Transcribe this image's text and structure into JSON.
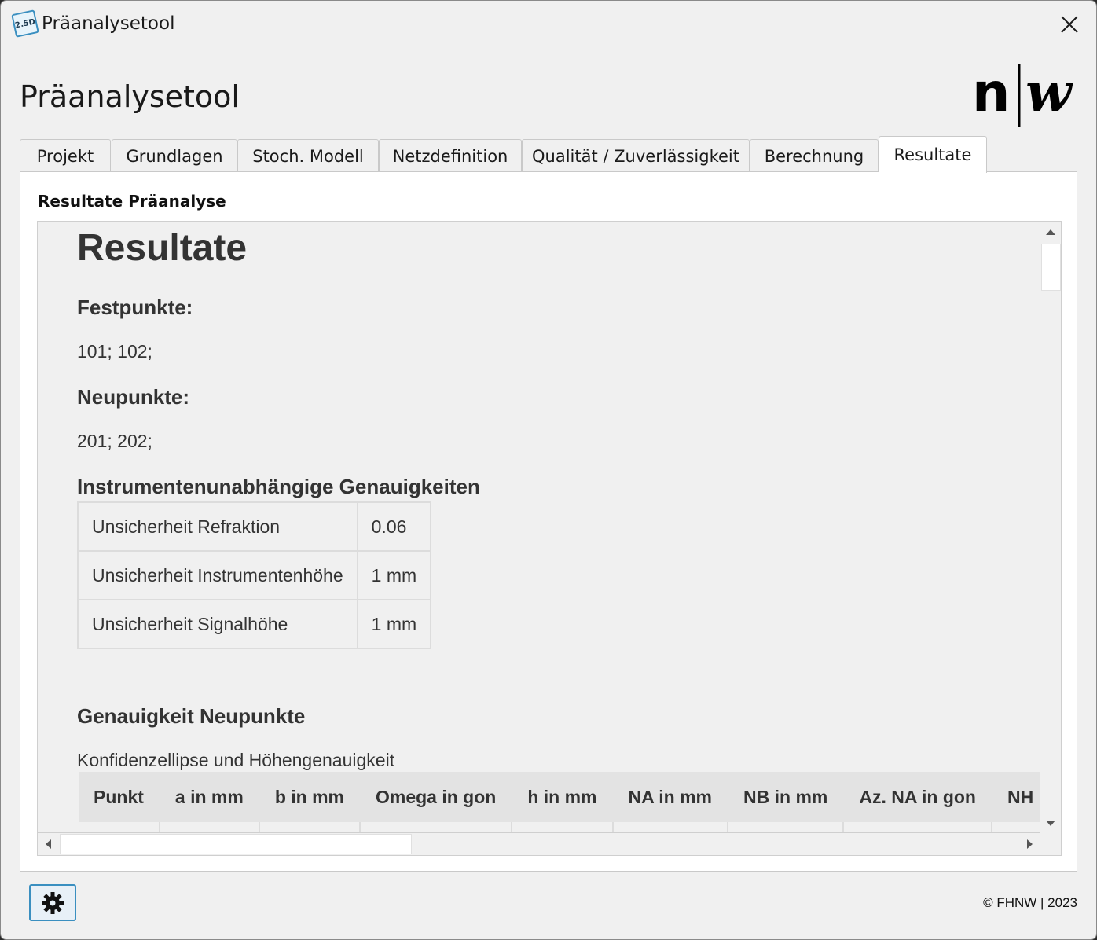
{
  "window": {
    "title": "Präanalysetool",
    "icon_label": "2.5D"
  },
  "app": {
    "title": "Präanalysetool",
    "logo_left": "n",
    "logo_right": "w"
  },
  "tabs": [
    {
      "label": "Projekt"
    },
    {
      "label": "Grundlagen"
    },
    {
      "label": "Stoch. Modell"
    },
    {
      "label": "Netzdefinition"
    },
    {
      "label": "Qualität / Zuverlässigkeit"
    },
    {
      "label": "Berechnung"
    },
    {
      "label": "Resultate"
    }
  ],
  "active_tab": "Resultate",
  "panel": {
    "heading": "Resultate Präanalyse"
  },
  "report": {
    "title": "Resultate",
    "festpunkte_heading": "Festpunkte:",
    "festpunkte_value": "101; 102;",
    "neupunkte_heading": "Neupunkte:",
    "neupunkte_value": "201; 202;",
    "genauigkeiten_heading": "Instrumentenunabhängige Genauigkeiten",
    "parameters": [
      {
        "label": "Unsicherheit Refraktion",
        "value": "0.06"
      },
      {
        "label": "Unsicherheit Instrumentenhöhe",
        "value": "1 mm"
      },
      {
        "label": "Unsicherheit Signalhöhe",
        "value": "1 mm"
      }
    ],
    "neupunkte_genauigkeit_heading": "Genauigkeit Neupunkte",
    "neupunkte_genauigkeit_subtitle": "Konfidenzellipse und Höhengenauigkeit",
    "results_columns": [
      "Punkt",
      "a in mm",
      "b in mm",
      "Omega in gon",
      "h in mm",
      "NA in mm",
      "NB in mm",
      "Az. NA in gon",
      "NH i"
    ]
  },
  "footer": {
    "copyright": "© FHNW | 2023"
  },
  "icons": {
    "close": "close-icon",
    "settings": "gear-icon",
    "scroll_up": "triangle-up-icon",
    "scroll_down": "triangle-down-icon",
    "scroll_left": "triangle-left-icon",
    "scroll_right": "triangle-right-icon"
  },
  "colors": {
    "accent": "#3a8fc0",
    "window_bg": "#f0f0f0",
    "panel_bg": "#ffffff",
    "table_header_bg": "#e3e3e3",
    "text": "#333333"
  }
}
